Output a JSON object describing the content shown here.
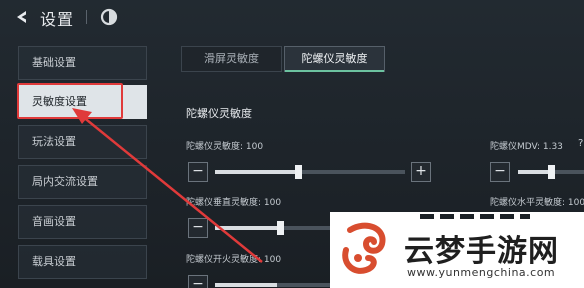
{
  "header": {
    "title": "设置",
    "back_icon": "back-arrow-icon",
    "logo_icon": "game-logo-icon"
  },
  "sidebar": {
    "items": [
      {
        "label": "基础设置",
        "active": false
      },
      {
        "label": "灵敏度设置",
        "active": true
      },
      {
        "label": "玩法设置",
        "active": false
      },
      {
        "label": "局内交流设置",
        "active": false
      },
      {
        "label": "音画设置",
        "active": false
      },
      {
        "label": "载具设置",
        "active": false
      }
    ]
  },
  "tabs": [
    {
      "label": "滑屏灵敏度",
      "active": false
    },
    {
      "label": "陀螺仪灵敏度",
      "active": true
    }
  ],
  "section": {
    "title": "陀螺仪灵敏度"
  },
  "settings": {
    "gyro": {
      "label": "陀螺仪灵敏度: 100",
      "value_fraction": 0.42
    },
    "gyro_mdv": {
      "label": "陀螺仪MDV: 1.33",
      "help": "?"
    },
    "gyro_vertical": {
      "label": "陀螺仪垂直灵敏度: 100"
    },
    "gyro_horizontal": {
      "label": "陀螺仪水平灵敏度: 100"
    },
    "gyro_fire": {
      "label": "陀螺仪开火灵敏度: 100"
    }
  },
  "buttons": {
    "minus": "−",
    "plus": "+"
  },
  "watermark": {
    "name": "云梦手游网",
    "url": "www.yunmengchina.com"
  },
  "colors": {
    "highlight": "#e03a3a",
    "tab_accent": "#6cc2a0",
    "active_item": "#dfe4e8"
  }
}
